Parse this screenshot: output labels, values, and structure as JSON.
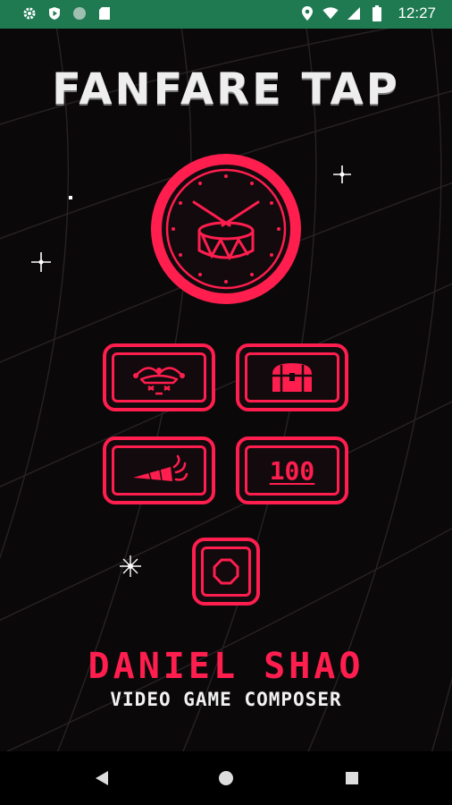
{
  "status_bar": {
    "time": "12:27",
    "left_icons": [
      "gear-icon",
      "shield-play-icon",
      "circle-icon",
      "sd-card-icon"
    ],
    "right_icons": [
      "location-icon",
      "wifi-icon",
      "signal-icon",
      "battery-icon"
    ],
    "background": "#1f7a52"
  },
  "app": {
    "title": "FANFARE TAP",
    "accent_color": "#ff1e4e"
  },
  "buttons": {
    "drum": {
      "icon": "drum-icon"
    },
    "jester": {
      "icon": "jester-hat-icon"
    },
    "chest": {
      "icon": "treasure-chest-icon"
    },
    "party_horn": {
      "icon": "party-horn-icon"
    },
    "hundred": {
      "label": "100"
    },
    "stop": {
      "icon": "stop-octagon-icon"
    }
  },
  "footer": {
    "composer_name": "DANIEL SHAO",
    "composer_role": "VIDEO GAME COMPOSER"
  },
  "nav": {
    "back": "back-triangle-icon",
    "home": "home-circle-icon",
    "recents": "recents-square-icon"
  }
}
